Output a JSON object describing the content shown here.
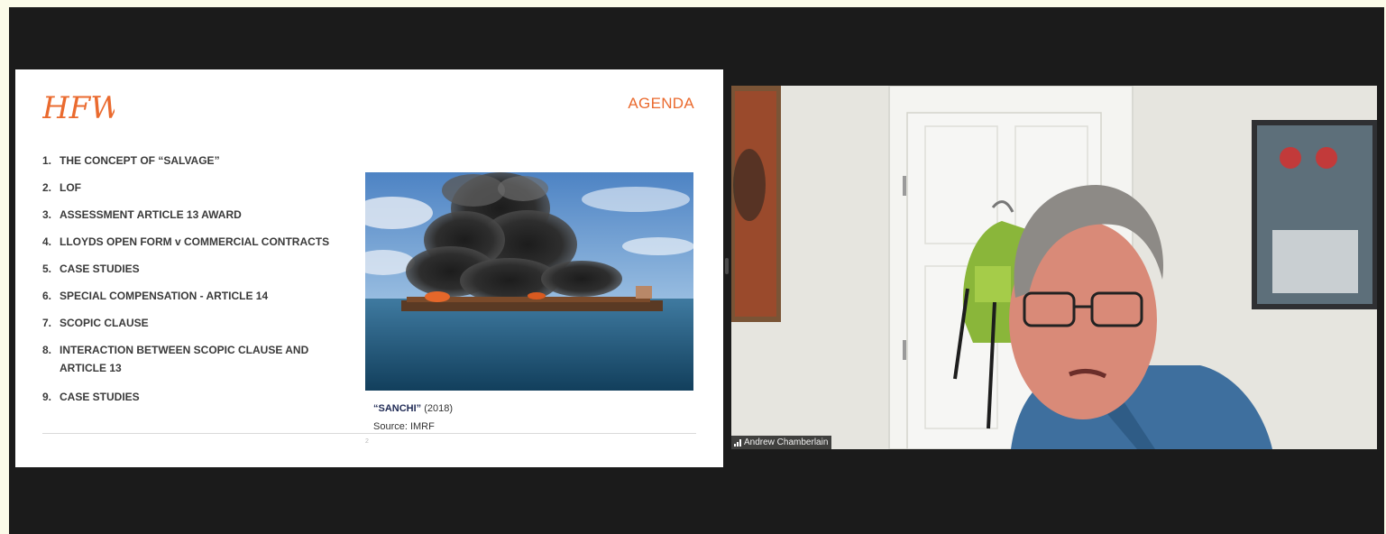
{
  "slide": {
    "logo_text": "HFW",
    "title": "AGENDA",
    "agenda": [
      {
        "num": "1.",
        "text": "THE CONCEPT OF “SALVAGE”"
      },
      {
        "num": "2.",
        "text": "LOF"
      },
      {
        "num": "3.",
        "text": "ASSESSMENT ARTICLE 13 AWARD"
      },
      {
        "num": "4.",
        "text": "LLOYDS OPEN FORM v COMMERCIAL CONTRACTS"
      },
      {
        "num": "5.",
        "text": "CASE STUDIES"
      },
      {
        "num": "6.",
        "text": "SPECIAL COMPENSATION - ARTICLE 14"
      },
      {
        "num": "7.",
        "text": "SCOPIC CLAUSE"
      },
      {
        "num": "8.",
        "text": "INTERACTION BETWEEN SCOPIC CLAUSE AND ARTICLE 13"
      },
      {
        "num": "9.",
        "text": "CASE STUDIES"
      }
    ],
    "caption": {
      "ship": "“SANCHI”",
      "year": " (2018)",
      "source": "Source: IMRF"
    },
    "page_number": "2",
    "accent_color": "#ea6a2e"
  },
  "video": {
    "participant_name": "Andrew Chamberlain",
    "signal_icon": "signal-bars-icon"
  }
}
